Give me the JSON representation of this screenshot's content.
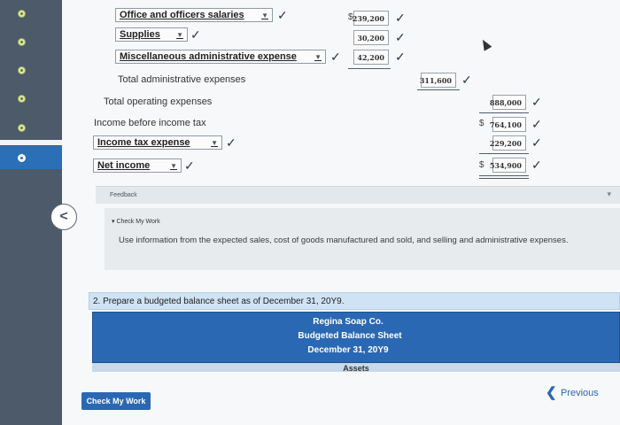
{
  "income_statement": {
    "office": {
      "label": "Office and officers salaries",
      "amount": "239,200",
      "dollar": "$"
    },
    "supplies": {
      "label": "Supplies",
      "amount": "30,200"
    },
    "misc": {
      "label": "Miscellaneous administrative expense",
      "amount": "42,200"
    },
    "total_admin": {
      "label": "Total administrative expenses",
      "amount": "311,600"
    },
    "total_operating": {
      "label": "Total operating expenses",
      "amount": "888,000"
    },
    "income_before_tax": {
      "label": "Income before income tax",
      "amount": "764,100",
      "dollar": "$"
    },
    "income_tax": {
      "label": "Income tax expense",
      "amount": "229,200"
    },
    "net_income": {
      "label": "Net income",
      "amount": "534,900",
      "dollar": "$"
    },
    "check_mark": "✓"
  },
  "feedback": {
    "label": "Feedback",
    "check_title": "Check My Work",
    "text": "Use information from the expected sales, cost of goods manufactured and sold, and selling and administrative expenses."
  },
  "question2": {
    "prompt": "2.  Prepare a budgeted balance sheet as of December 31, 20Y9.",
    "company": "Regina Soap Co.",
    "statement": "Budgeted Balance Sheet",
    "date": "December 31, 20Y9",
    "section": "Assets"
  },
  "footer": {
    "check_button": "Check My Work",
    "previous": "Previous"
  },
  "icons": {
    "back": "chevron-left-icon",
    "previous": "chevron-left-icon",
    "dropdown": "caret-down-icon",
    "check": "check-mark-icon"
  },
  "colors": {
    "accent": "#2a68b3",
    "rail": "#4c5a69",
    "check": "#2a3a48"
  }
}
